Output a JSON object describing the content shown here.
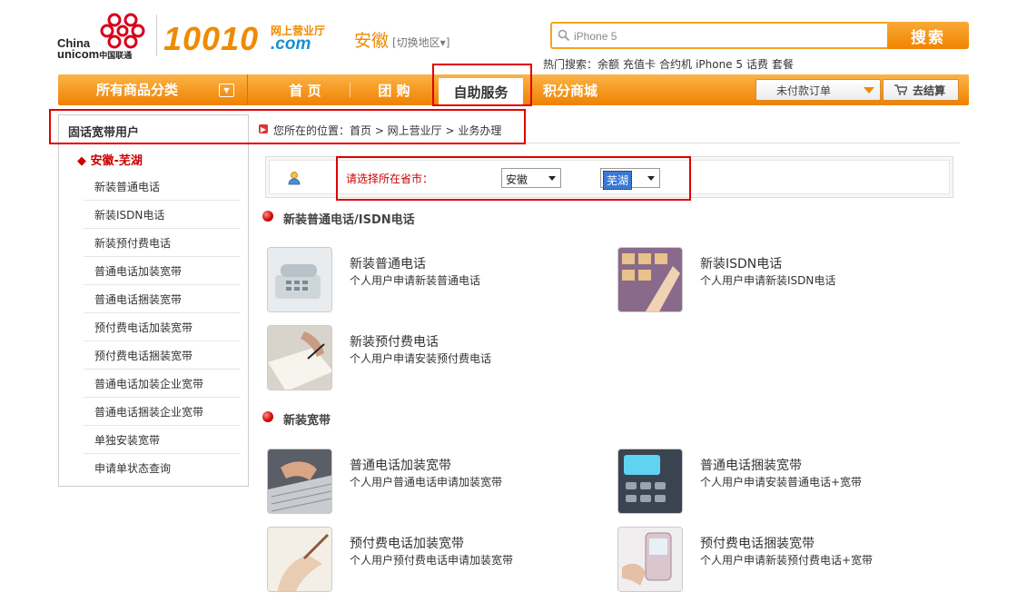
{
  "brand": {
    "china": "China",
    "unicom": "unicom",
    "unicom_cn": "中国联通",
    "number": "10010",
    "portal_cn": "网上营业厅",
    "domain": ".com"
  },
  "region": {
    "name": "安徽",
    "switch_label": "[切换地区▾]"
  },
  "search": {
    "value": "iPhone 5",
    "button": "搜索",
    "hot_label": "热门搜索：",
    "hot_terms": [
      "余额",
      "充值卡",
      "合约机",
      "iPhone 5",
      "话费",
      "套餐"
    ]
  },
  "nav": {
    "category_label": "所有商品分类",
    "items": [
      "首 页",
      "团 购",
      "自助服务",
      "积分商城"
    ],
    "unpaid_orders": "未付款订单",
    "checkout": "去结算"
  },
  "sidebar": {
    "title": "固话宽带用户",
    "region": "◆ 安徽-芜湖",
    "items": [
      "新装普通电话",
      "新装ISDN电话",
      "新装预付费电话",
      "普通电话加装宽带",
      "普通电话捆装宽带",
      "预付费电话加装宽带",
      "预付费电话捆装宽带",
      "普通电话加装企业宽带",
      "普通电话捆装企业宽带",
      "单独安装宽带",
      "申请单状态查询"
    ]
  },
  "breadcrumb": "您所在的位置：首页 > 网上营业厅 > 业务办理",
  "selector": {
    "label": "请选择所在省市：",
    "province": "安徽",
    "city": "芜湖"
  },
  "sections": [
    {
      "title": "新装普通电话/ISDN电话",
      "cards": [
        {
          "title": "新装普通电话",
          "desc": "个人用户申请新装普通电话",
          "image": "telephone-photo"
        },
        {
          "title": "新装ISDN电话",
          "desc": "个人用户申请新装ISDN电话",
          "image": "keypad-photo"
        },
        {
          "title": "新装预付费电话",
          "desc": "个人用户申请安装预付费电话",
          "image": "signing-photo"
        }
      ]
    },
    {
      "title": "新装宽带",
      "cards": [
        {
          "title": "普通电话加装宽带",
          "desc": "个人用户普通电话申请加装宽带",
          "image": "keyboard-photo"
        },
        {
          "title": "普通电话捆装宽带",
          "desc": "个人用户申请安装普通电话+宽带",
          "image": "phone-keys-photo"
        },
        {
          "title": "预付费电话加装宽带",
          "desc": "个人用户预付费电话申请加装宽带",
          "image": "writing-photo"
        },
        {
          "title": "预付费电话捆装宽带",
          "desc": "个人用户申请新装预付费电话+宽带",
          "image": "mobile-photo"
        }
      ]
    }
  ],
  "colors": {
    "brand_orange": "#f08a00",
    "nav_orange": "#ef8100",
    "highlight_red": "#e00000",
    "logo_blue": "#1a8fd0"
  }
}
